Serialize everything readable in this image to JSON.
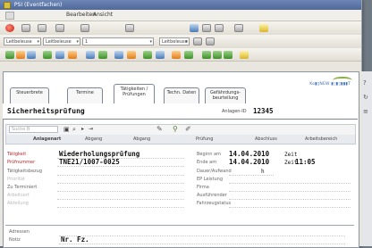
{
  "window": {
    "title": "PSI (Eventfachen)"
  },
  "menu": {
    "items": [
      "Bearbeiten",
      "Ansicht"
    ]
  },
  "toolbar": {
    "combo1": "Leitbeleuse",
    "combo2": "Leitbeleuse",
    "combo3": "1",
    "combo4": "Leitbeleuse"
  },
  "tabs": [
    {
      "label": "Steuerbrete"
    },
    {
      "label": "Termine"
    },
    {
      "label": "Tätigkeiten /\nPrüfungen"
    },
    {
      "label": "Techn. Daten"
    },
    {
      "label": "Gefährdungs-\nbeurteilung"
    }
  ],
  "logo": {
    "text": "Ko▮▯NEW ▮▯▮▯▮▮▮T"
  },
  "record": {
    "name": "Sicherheitsprüfung",
    "id_label": "Anlagen-ID",
    "id_value": "12345"
  },
  "grid": {
    "search_placeholder": "Suche B",
    "columns": [
      "Anlagenart",
      "Abgang",
      "Abgang",
      "Prüfung",
      "Abschluss",
      "Arbeitsbereich"
    ]
  },
  "form": {
    "left_labels": [
      "Tätigkeit",
      "Prüfnummer",
      "Tätigkeitsbezug",
      "Priorität",
      "Zu Terminiert",
      "Arbeitsort",
      "Abteilung"
    ],
    "right_labels": [
      "Beginn am",
      "Ende am",
      "Dauer/Aufwand",
      "EP Leistung",
      "Firma",
      "Ausführender",
      "Fahrzeugstatus"
    ],
    "taetigkeit": "Wiederholungsprüfung",
    "pruefnummer": "TNE21/1007-0025",
    "beginn_date": "14.04.2010",
    "beginn_unit": "Zeit",
    "ende_date": "14.04.2010",
    "ende_unit": "Zeit",
    "ende_time": "11:05",
    "dauer_unit": "h"
  },
  "bottom": {
    "label1": "Adressen",
    "label2": "Notiz",
    "value2": "Nr. Fz."
  }
}
